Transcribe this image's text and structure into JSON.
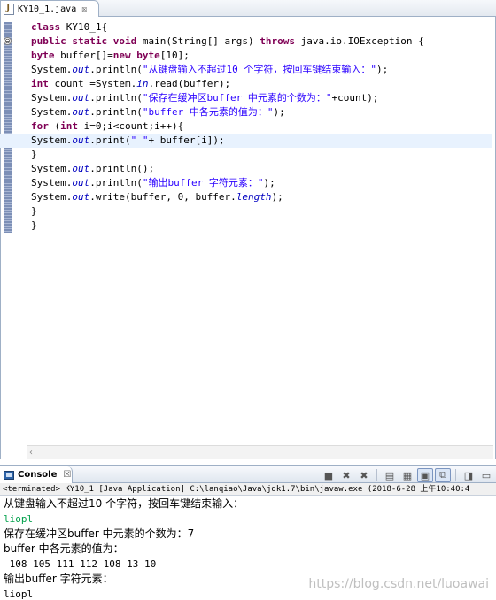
{
  "editor": {
    "tab_title": "KY10_1.java",
    "close_glyph": "☒",
    "fold_glyph": "⊖",
    "lines": [
      [
        {
          "t": "kw",
          "v": "class"
        },
        {
          "t": "p",
          "v": " KY10_1{"
        }
      ],
      [
        {
          "t": "kw",
          "v": "public static void"
        },
        {
          "t": "p",
          "v": " main(String[] args) "
        },
        {
          "t": "kw",
          "v": "throws"
        },
        {
          "t": "p",
          "v": " java.io.IOException {"
        }
      ],
      [
        {
          "t": "kw",
          "v": "byte"
        },
        {
          "t": "p",
          "v": " buffer[]="
        },
        {
          "t": "kw",
          "v": "new byte"
        },
        {
          "t": "p",
          "v": "[10];"
        }
      ],
      [
        {
          "t": "p",
          "v": "System."
        },
        {
          "t": "st",
          "v": "out"
        },
        {
          "t": "p",
          "v": ".println("
        },
        {
          "t": "str",
          "v": "\"从键盘输入不超过10 个字符，按回车键结束输入：\""
        },
        {
          "t": "p",
          "v": ");"
        }
      ],
      [
        {
          "t": "kw",
          "v": "int"
        },
        {
          "t": "p",
          "v": " count =System."
        },
        {
          "t": "st",
          "v": "in"
        },
        {
          "t": "p",
          "v": ".read(buffer);"
        }
      ],
      [
        {
          "t": "p",
          "v": "System."
        },
        {
          "t": "st",
          "v": "out"
        },
        {
          "t": "p",
          "v": ".println("
        },
        {
          "t": "str",
          "v": "\"保存在缓冲区buffer 中元素的个数为：\""
        },
        {
          "t": "p",
          "v": "+count);"
        }
      ],
      [
        {
          "t": "p",
          "v": "System."
        },
        {
          "t": "st",
          "v": "out"
        },
        {
          "t": "p",
          "v": ".println("
        },
        {
          "t": "str",
          "v": "\"buffer 中各元素的值为：\""
        },
        {
          "t": "p",
          "v": ");"
        }
      ],
      [
        {
          "t": "kw",
          "v": "for"
        },
        {
          "t": "p",
          "v": " ("
        },
        {
          "t": "kw",
          "v": "int"
        },
        {
          "t": "p",
          "v": " i=0;i<count;i++){"
        }
      ],
      [
        {
          "t": "p",
          "v": "System."
        },
        {
          "t": "st",
          "v": "out"
        },
        {
          "t": "p",
          "v": ".print("
        },
        {
          "t": "str",
          "v": "\" \""
        },
        {
          "t": "p",
          "v": "+ buffer[i]);"
        }
      ],
      [
        {
          "t": "p",
          "v": "}"
        }
      ],
      [
        {
          "t": "p",
          "v": "System."
        },
        {
          "t": "st",
          "v": "out"
        },
        {
          "t": "p",
          "v": ".println();"
        }
      ],
      [
        {
          "t": "p",
          "v": "System."
        },
        {
          "t": "st",
          "v": "out"
        },
        {
          "t": "p",
          "v": ".println("
        },
        {
          "t": "str",
          "v": "\"输出buffer 字符元素：\""
        },
        {
          "t": "p",
          "v": ");"
        }
      ],
      [
        {
          "t": "p",
          "v": "System."
        },
        {
          "t": "st",
          "v": "out"
        },
        {
          "t": "p",
          "v": ".write(buffer, 0, buffer."
        },
        {
          "t": "st",
          "v": "length"
        },
        {
          "t": "p",
          "v": ");"
        }
      ],
      [
        {
          "t": "p",
          "v": "}"
        }
      ],
      [
        {
          "t": "p",
          "v": "}"
        }
      ]
    ],
    "current_line": 8
  },
  "console": {
    "tab_title": "Console",
    "close_glyph": "☒",
    "status": "<terminated> KY10_1 [Java Application] C:\\lanqiao\\Java\\jdk1.7\\bin\\javaw.exe (2018-6-28 上午10:40:4",
    "output": [
      {
        "kind": "cjk",
        "text": "从键盘输入不超过10 个字符，按回车键结束输入："
      },
      {
        "kind": "input",
        "text": "liopl"
      },
      {
        "kind": "cjk",
        "text": "保存在缓冲区buffer 中元素的个数为：7"
      },
      {
        "kind": "cjk",
        "text": "buffer 中各元素的值为："
      },
      {
        "kind": "plain",
        "text": " 108 105 111 112 108 13 10"
      },
      {
        "kind": "cjk",
        "text": "输出buffer 字符元素："
      },
      {
        "kind": "plain",
        "text": "liopl"
      }
    ],
    "toolbar": [
      {
        "name": "terminate-icon",
        "glyph": "■",
        "pressed": false
      },
      {
        "name": "remove-launch-icon",
        "glyph": "✖",
        "pressed": false
      },
      {
        "name": "remove-all-icon",
        "glyph": "✖",
        "pressed": false
      },
      {
        "sep": true
      },
      {
        "name": "clear-console-icon",
        "glyph": "▤",
        "pressed": false
      },
      {
        "name": "scroll-lock-icon",
        "glyph": "▦",
        "pressed": false
      },
      {
        "name": "word-wrap-icon",
        "glyph": "▣",
        "pressed": true
      },
      {
        "name": "pin-console-icon",
        "glyph": "⧉",
        "pressed": true
      },
      {
        "sep": true
      },
      {
        "name": "open-console-icon",
        "glyph": "◨",
        "pressed": false
      },
      {
        "name": "view-menu-icon",
        "glyph": "▭",
        "pressed": false
      }
    ]
  },
  "watermark": "https://blog.csdn.net/luoawai",
  "scroll_arrow": "‹"
}
